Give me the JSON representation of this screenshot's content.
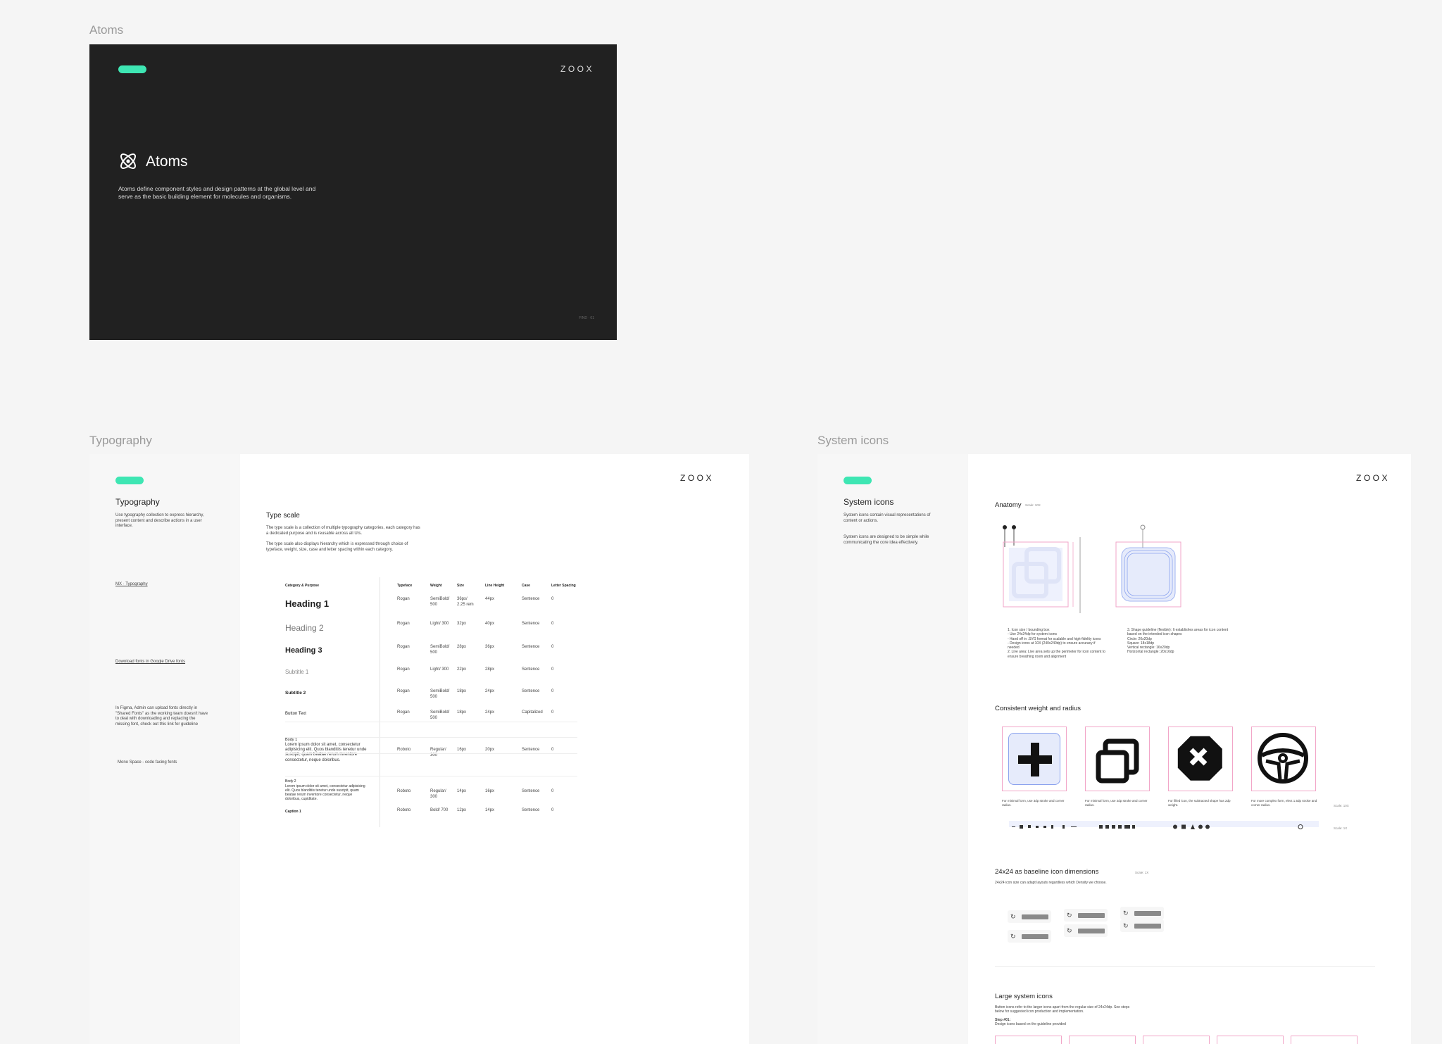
{
  "frames": {
    "atoms": {
      "label": "Atoms",
      "logo": "ZOOX",
      "title": "Atoms",
      "description": "Atoms define component styles and design patterns at the global level and serve as the basic building element for molecules and organisms.",
      "footer": "FIND · 01"
    },
    "typography": {
      "label": "Typography",
      "logo": "ZOOX",
      "title": "Typography",
      "intro": "Use typography collection to express hierarchy, present content and describe actions in a user interface.",
      "link_typography": "MX · Typography",
      "link_download": "Download fonts in Google Drive fonts",
      "note": "In Figma, Admin can upload fonts directly in \"Shared Fonts\" as the working team doesn't have to deal with downloading and replacing the missing font, check out this link for guideline",
      "mono_note": "Mono Space - code facing fonts",
      "scale_title": "Type scale",
      "scale_desc1": "The type scale is a collection of multiple typography categories, each category has a dedicated purpose and is reusable across all UIs.",
      "scale_desc2": "The type scale also displays hierarchy which is expressed through choice of typeface, weight, size, case and letter spacing within each category.",
      "columns": [
        "Category & Purpose",
        "Typeface",
        "Weight",
        "Size",
        "Line Height",
        "Case",
        "Letter Spacing"
      ],
      "rows": [
        {
          "name": "Heading 1",
          "typeface": "Rogan",
          "weight": "SemiBold/ 500",
          "size": "36px/ 2.25 rem",
          "lh": "44px",
          "case": "Sentence",
          "ls": "0"
        },
        {
          "name": "Heading 2",
          "typeface": "Rogan",
          "weight": "Light/ 300",
          "size": "32px",
          "lh": "40px",
          "case": "Sentence",
          "ls": "0"
        },
        {
          "name": "Heading 3",
          "typeface": "Rogan",
          "weight": "SemiBold/ 500",
          "size": "28px",
          "lh": "36px",
          "case": "Sentence",
          "ls": "0"
        },
        {
          "name": "Subtitle 1",
          "typeface": "Rogan",
          "weight": "Light/ 300",
          "size": "22px",
          "lh": "28px",
          "case": "Sentence",
          "ls": "0"
        },
        {
          "name": "Subtitle 2",
          "typeface": "Rogan",
          "weight": "SemiBold/ 500",
          "size": "18px",
          "lh": "24px",
          "case": "Sentence",
          "ls": "0"
        },
        {
          "name": "Button Text",
          "typeface": "Rogan",
          "weight": "SemiBold/ 500",
          "size": "18px",
          "lh": "24px",
          "case": "Capitalized",
          "ls": "0"
        },
        {
          "name": "Body 1",
          "sample": "Lorem ipsum dolor sit amet, consectetur adipisicing elit. Quos blanditiis tenetur unde suscipit, quam beatae rerum inventore consectetur, neque doloribus.",
          "typeface": "Roboto",
          "weight": "Regular/ 300",
          "size": "16px",
          "lh": "20px",
          "case": "Sentence",
          "ls": "0"
        },
        {
          "name": "Body 2",
          "sample": "Lorem ipsum dolor sit amet, consectetur adipisicing elit. Quos blanditiis tenetur unde suscipit, quam beatae rerum inventore consectetur, neque doloribus, cupiditate.",
          "typeface": "Roboto",
          "weight": "Regular/ 300",
          "size": "14px",
          "lh": "16px",
          "case": "Sentence",
          "ls": "0"
        },
        {
          "name": "Caption 1",
          "typeface": "Roboto",
          "weight": "Bold/ 700",
          "size": "12px",
          "lh": "14px",
          "case": "Sentence",
          "ls": "0"
        }
      ]
    },
    "icons": {
      "label": "System icons",
      "logo": "ZOOX",
      "title": "System icons",
      "intro1": "System icons contain visual representations of content or actions.",
      "intro2": "System icons are designed to be simple while communicating the core idea effectively.",
      "anatomy": "Anatomy",
      "anatomy_scale": "Scale: 10X",
      "anatomy_note1": "1. Icon size / bounding box\n- Use 24x24dp for system icons\n- Hand off in .SVG format for scalable and high-fidelity icons\n- Design icons at 10X (240x240dp) to ensure accuracy if needed\n2. Live area: Live area sets up the perimeter for icon content to ensure breathing room and alignment",
      "anatomy_note2": "3. Shape guideline (flexible): It establishes areas for icon content based on the intended icon shapes\nCircle: 20x20dp\nSquare: 18x18dp\nVertical rectangle: 16x20dp\nHorizontal rectangle: 20x16dp",
      "weight_title": "Consistent weight and radius",
      "captions": [
        "For minimal form, use 3dp stroke and corner radius.",
        "For minimal form, use 2dp stroke and corner radius.",
        "For filled icon, the subtracted shape has 2dp weight.",
        "For more complex form, elect 1.5dp stroke and corner radius."
      ],
      "scale_10x": "Scale: 10X",
      "scale_1x": "Scale: 1X",
      "baseline_title": "24x24 as baseline icon dimensions",
      "baseline_scale": "Scale: 1X",
      "baseline_desc": "24x24 icon size can adapt layouts regardless which Density we choose.",
      "large_title": "Large system icons",
      "large_desc": "Button icons refer to the larger icons apart from the regular size of 24x24dp. See steps below for suggested icon production and implementation.",
      "step_title": "Step #01:",
      "step_desc": "Design icons based on the guideline provided"
    }
  },
  "colors": {
    "accent": "#3ee6b3",
    "dark": "#222222",
    "pink": "#f2a6c8",
    "blue": "#b9c8f5"
  },
  "icons": [
    "atom-icon",
    "plus-icon",
    "copy-icon",
    "close-octagon-icon",
    "steering-wheel-icon",
    "refresh-icon"
  ]
}
